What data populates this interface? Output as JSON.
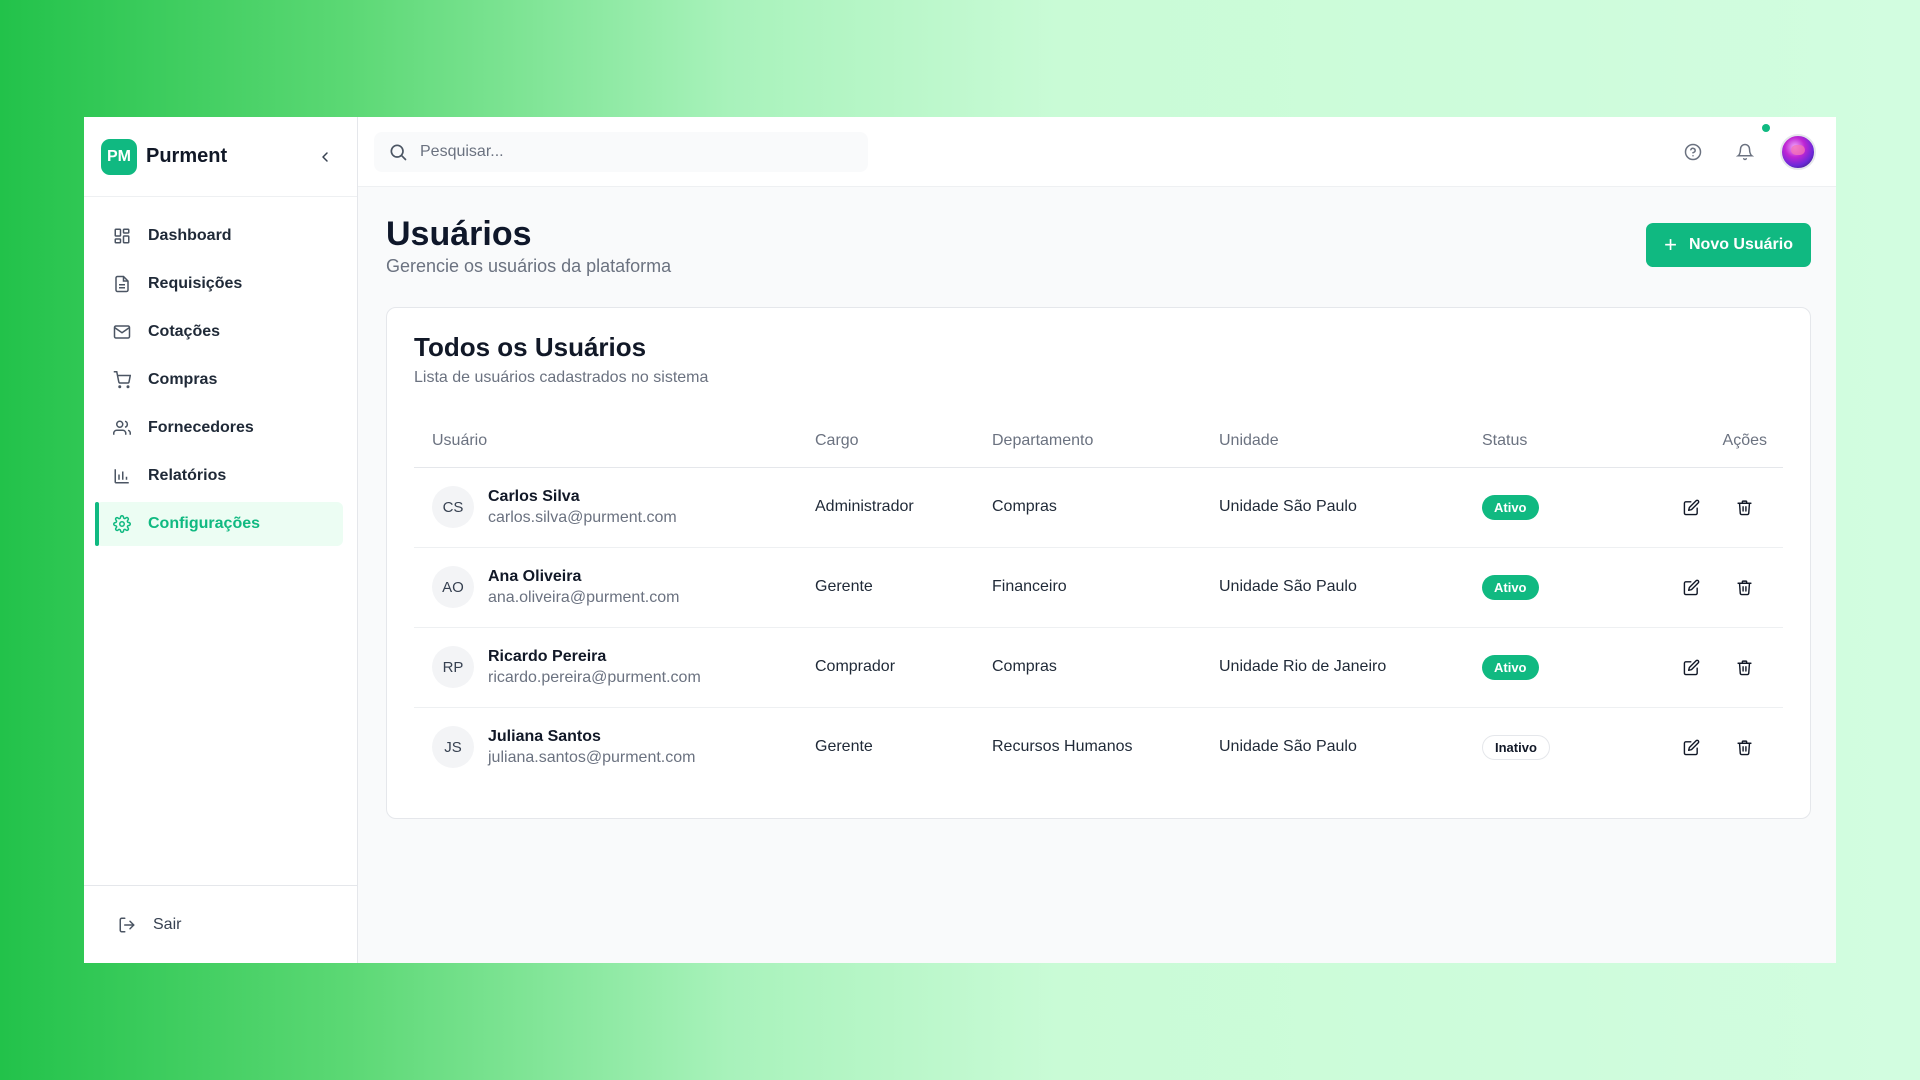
{
  "brand": {
    "logo_text": "PM",
    "name": "Purment"
  },
  "sidebar": {
    "items": [
      {
        "label": "Dashboard",
        "icon": "dashboard-grid-icon"
      },
      {
        "label": "Requisições",
        "icon": "document-icon"
      },
      {
        "label": "Cotações",
        "icon": "mail-icon"
      },
      {
        "label": "Compras",
        "icon": "cart-icon"
      },
      {
        "label": "Fornecedores",
        "icon": "users-icon"
      },
      {
        "label": "Relatórios",
        "icon": "bar-chart-icon"
      },
      {
        "label": "Configurações",
        "icon": "gear-icon",
        "active": true
      }
    ],
    "logout_label": "Sair"
  },
  "topbar": {
    "search_placeholder": "Pesquisar..."
  },
  "page": {
    "title": "Usuários",
    "subtitle": "Gerencie os usuários da plataforma",
    "new_button_label": "Novo Usuário"
  },
  "card": {
    "title": "Todos os Usuários",
    "subtitle": "Lista de usuários cadastrados no sistema"
  },
  "table": {
    "headers": [
      "Usuário",
      "Cargo",
      "Departamento",
      "Unidade",
      "Status",
      "Ações"
    ],
    "rows": [
      {
        "initials": "CS",
        "name": "Carlos Silva",
        "email": "carlos.silva@purment.com",
        "cargo": "Administrador",
        "departamento": "Compras",
        "unidade": "Unidade São Paulo",
        "status": "Ativo"
      },
      {
        "initials": "AO",
        "name": "Ana Oliveira",
        "email": "ana.oliveira@purment.com",
        "cargo": "Gerente",
        "departamento": "Financeiro",
        "unidade": "Unidade São Paulo",
        "status": "Ativo"
      },
      {
        "initials": "RP",
        "name": "Ricardo Pereira",
        "email": "ricardo.pereira@purment.com",
        "cargo": "Comprador",
        "departamento": "Compras",
        "unidade": "Unidade Rio de Janeiro",
        "status": "Ativo"
      },
      {
        "initials": "JS",
        "name": "Juliana Santos",
        "email": "juliana.santos@purment.com",
        "cargo": "Gerente",
        "departamento": "Recursos Humanos",
        "unidade": "Unidade São Paulo",
        "status": "Inativo"
      }
    ]
  },
  "colors": {
    "accent": "#10b981",
    "accent_soft": "#ecfdf3",
    "notification_dot": "#10b981"
  }
}
